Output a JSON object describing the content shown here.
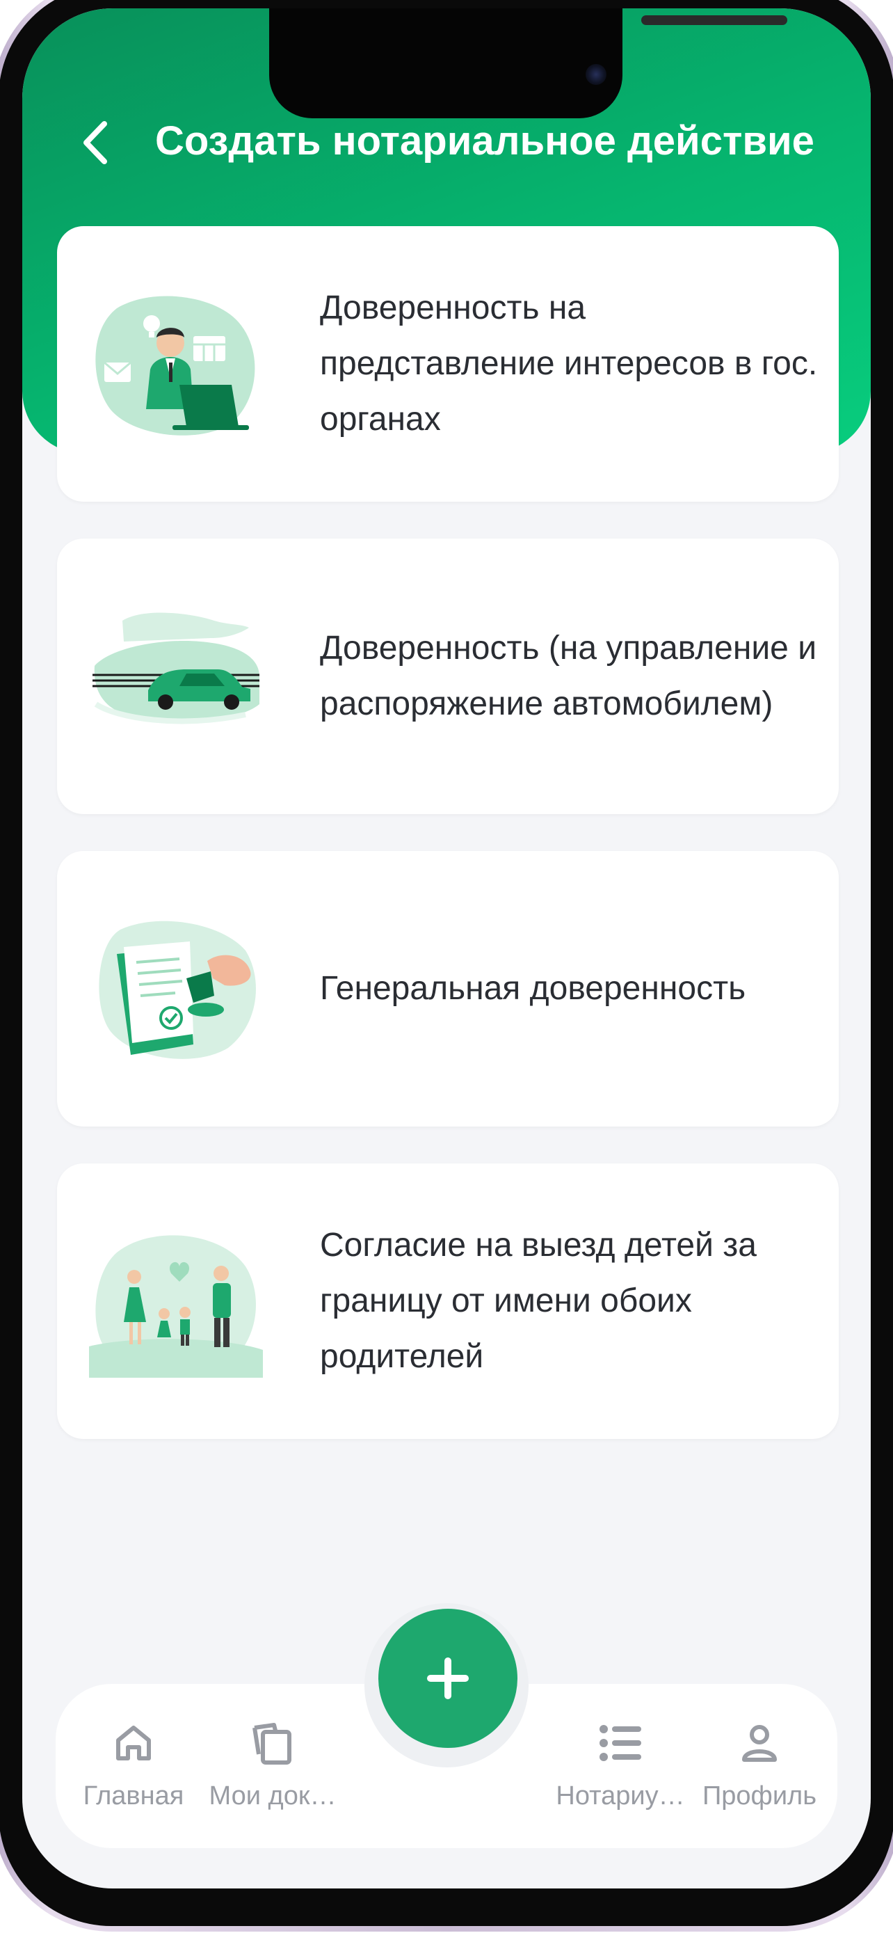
{
  "header": {
    "title": "Создать нотариальное действие",
    "back_icon": "chevron-left-icon"
  },
  "cards": [
    {
      "label": "Доверенность на представление интересов в гос. органах",
      "illustration": "businessman-laptop-illustration"
    },
    {
      "label": "Доверенность (на управление и распоряжение автомобилем)",
      "illustration": "car-illustration"
    },
    {
      "label": "Генеральная доверенность",
      "illustration": "document-stamp-illustration"
    },
    {
      "label": "Согласие на выезд детей за границу от имени обоих родителей",
      "illustration": "family-illustration"
    }
  ],
  "fab": {
    "icon": "plus-icon"
  },
  "nav": {
    "items": [
      {
        "label": "Главная",
        "icon": "home-icon"
      },
      {
        "label": "Мои док…",
        "icon": "documents-icon"
      },
      {
        "label": "Нотариу…",
        "icon": "list-icon"
      },
      {
        "label": "Профиль",
        "icon": "profile-icon"
      }
    ]
  },
  "colors": {
    "brand_green": "#06b56f",
    "fab_green": "#1ea86e",
    "screen_bg": "#f4f5f8",
    "nav_text": "#999ca3",
    "card_text": "#2a2d33"
  }
}
